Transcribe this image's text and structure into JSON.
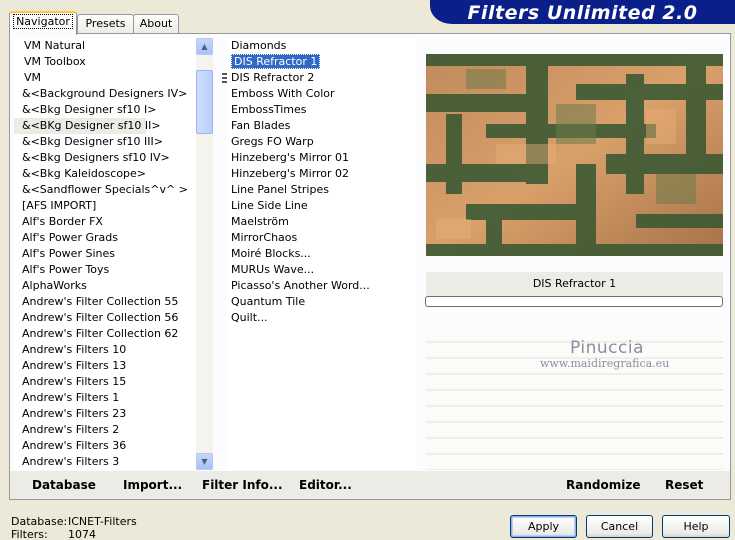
{
  "title": "Filters Unlimited 2.0",
  "tabs": [
    "Navigator",
    "Presets",
    "About"
  ],
  "categories": [
    "VM Natural",
    "VM Toolbox",
    "VM",
    "&<Background Designers IV>",
    "&<Bkg Designer sf10 I>",
    "&<BKg Designer sf10 II>",
    "&<Bkg Designer sf10 III>",
    "&<Bkg Designers sf10 IV>",
    "&<Bkg Kaleidoscope>",
    "&<Sandflower Specials^v^ >",
    "[AFS IMPORT]",
    "Alf's Border FX",
    "Alf's Power Grads",
    "Alf's Power Sines",
    "Alf's Power Toys",
    "AlphaWorks",
    "Andrew's Filter Collection 55",
    "Andrew's Filter Collection 56",
    "Andrew's Filter Collection 62",
    "Andrew's Filters 10",
    "Andrew's Filters 13",
    "Andrew's Filters 15",
    "Andrew's Filters 1",
    "Andrew's Filters 23",
    "Andrew's Filters 2",
    "Andrew's Filters 36",
    "Andrew's Filters 3"
  ],
  "filters": [
    "Diamonds",
    "DIS Refractor 1",
    "DIS Refractor 2",
    "Emboss With Color",
    "EmbossTimes",
    "Fan Blades",
    "Gregs FO Warp",
    "Hinzeberg's Mirror 01",
    "Hinzeberg's Mirror 02",
    "Line Panel Stripes",
    "Line Side Line",
    "Maelström",
    "MirrorChaos",
    "Moiré Blocks...",
    "MURUs Wave...",
    "Picasso's Another Word...",
    "Quantum Tile",
    "Quilt..."
  ],
  "selected_filter_name": "DIS Refractor 1",
  "commands": {
    "database": "Database",
    "import": "Import...",
    "filter_info": "Filter Info...",
    "editor": "Editor...",
    "randomize": "Randomize",
    "reset": "Reset"
  },
  "watermark": {
    "name": "Pinuccia",
    "url": "www.maidiregrafica.eu"
  },
  "status": {
    "database_label": "Database:",
    "database_value": "ICNET-Filters",
    "filters_label": "Filters:",
    "filters_value": "1074"
  },
  "buttons": {
    "apply": "Apply",
    "cancel": "Cancel",
    "help": "Help"
  },
  "colors": {
    "banner": "#0a1f8a",
    "selection": "#316ac5",
    "preview_green": "#3d5a34",
    "preview_tan": "#c89460"
  }
}
